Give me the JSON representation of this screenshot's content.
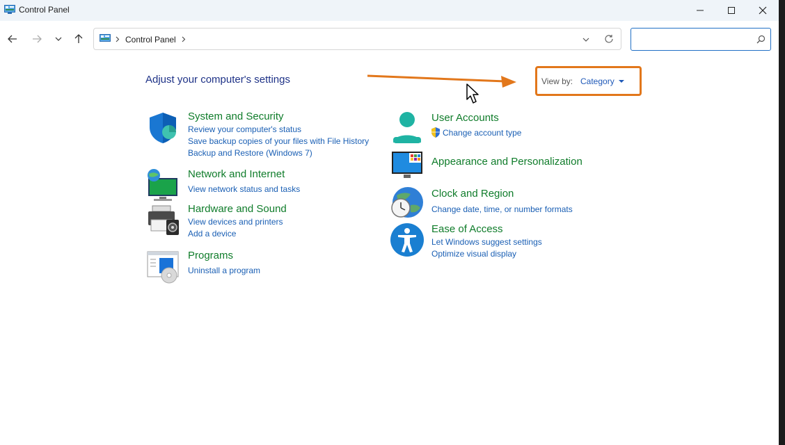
{
  "window": {
    "title": "Control Panel"
  },
  "address": {
    "crumb": "Control Panel",
    "search_placeholder": ""
  },
  "main": {
    "heading": "Adjust your computer's settings",
    "view_by": {
      "label": "View by:",
      "value": "Category"
    },
    "left": [
      {
        "title": "System and Security",
        "icon": "shield-icon",
        "links": [
          "Review your computer's status",
          "Save backup copies of your files with File History",
          "Backup and Restore (Windows 7)"
        ]
      },
      {
        "title": "Network and Internet",
        "icon": "network-icon",
        "links": [
          "View network status and tasks"
        ]
      },
      {
        "title": "Hardware and Sound",
        "icon": "printer-icon",
        "links": [
          "View devices and printers",
          "Add a device"
        ]
      },
      {
        "title": "Programs",
        "icon": "programs-icon",
        "links": [
          "Uninstall a program"
        ]
      }
    ],
    "right": [
      {
        "title": "User Accounts",
        "icon": "user-icon",
        "links": [
          "Change account type"
        ]
      },
      {
        "title": "Appearance and Personalization",
        "icon": "monitor-icon",
        "links": []
      },
      {
        "title": "Clock and Region",
        "icon": "clock-globe-icon",
        "links": [
          "Change date, time, or number formats"
        ]
      },
      {
        "title": "Ease of Access",
        "icon": "accessibility-icon",
        "links": [
          "Let Windows suggest settings",
          "Optimize visual display"
        ]
      }
    ]
  },
  "colors": {
    "accent": "#1f6fc5",
    "category_title": "#0f7c2a",
    "link": "#1a5fb4",
    "heading": "#1e3287",
    "annotation": "#e2771b"
  }
}
